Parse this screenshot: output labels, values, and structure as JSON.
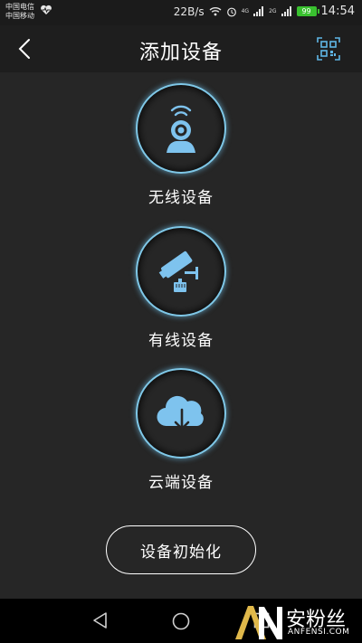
{
  "status_bar": {
    "carrier_1": "中国电信",
    "carrier_2": "中国移动",
    "net_speed": "22B/s",
    "net_label_1": "4G",
    "net_label_2": "2G",
    "battery": "99",
    "time": "14:54"
  },
  "header": {
    "title": "添加设备",
    "back_icon": "chevron-left-icon",
    "scan_icon": "qr-scan-icon"
  },
  "options": [
    {
      "label": "无线设备",
      "icon": "wireless-camera-icon"
    },
    {
      "label": "有线设备",
      "icon": "wired-camera-icon"
    },
    {
      "label": "云端设备",
      "icon": "cloud-download-icon"
    }
  ],
  "init_button": {
    "label": "设备初始化"
  },
  "colors": {
    "background": "#262626",
    "header": "#1e1e1e",
    "accent_ring": "#7fc8e8",
    "icon_blue": "#7ec3ee",
    "battery": "#39c12f"
  },
  "watermark": {
    "brand_cn": "安粉丝",
    "brand_en": "ANFENSI.COM"
  }
}
